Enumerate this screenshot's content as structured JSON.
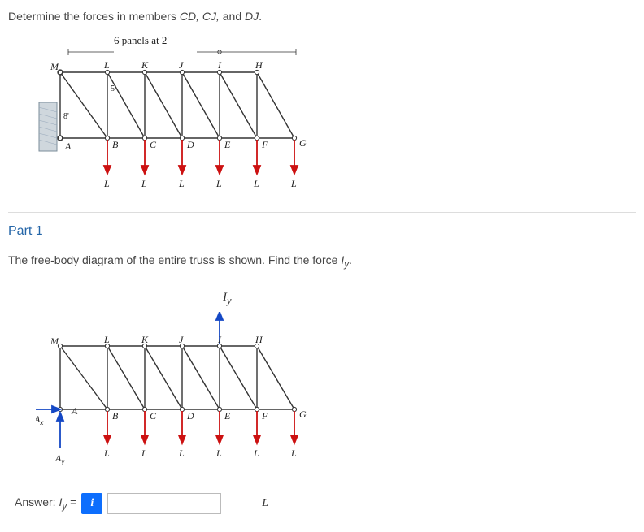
{
  "question_prefix": "Determine the forces in members ",
  "members": "CD, CJ,",
  "question_mid": " and ",
  "members2": "DJ",
  "question_suffix": ".",
  "panels_label": "6 panels at 2'",
  "dim_8": "8'",
  "dim_5": "5'",
  "labels_top": {
    "M": "M",
    "L": "L",
    "K": "K",
    "J": "J",
    "I": "I",
    "H": "H"
  },
  "labels_bot": {
    "A": "A",
    "B": "B",
    "C": "C",
    "D": "D",
    "E": "E",
    "F": "F",
    "G": "G"
  },
  "load_L": "L",
  "part1_title": "Part 1",
  "part1_text_prefix": "The free-body diagram of the entire truss is shown. Find the force ",
  "part1_var": "I",
  "part1_subscript": "y",
  "part1_suffix": ".",
  "Iy_display": "I",
  "Iy_sub": "y",
  "Ax": "A",
  "Ax_sub": "x",
  "Ay": "A",
  "Ay_sub": "y",
  "answer_label_prefix": "Answer: ",
  "answer_var": "I",
  "answer_sub": "y",
  "answer_eq": " = ",
  "info_icon": "i",
  "unit": "L"
}
